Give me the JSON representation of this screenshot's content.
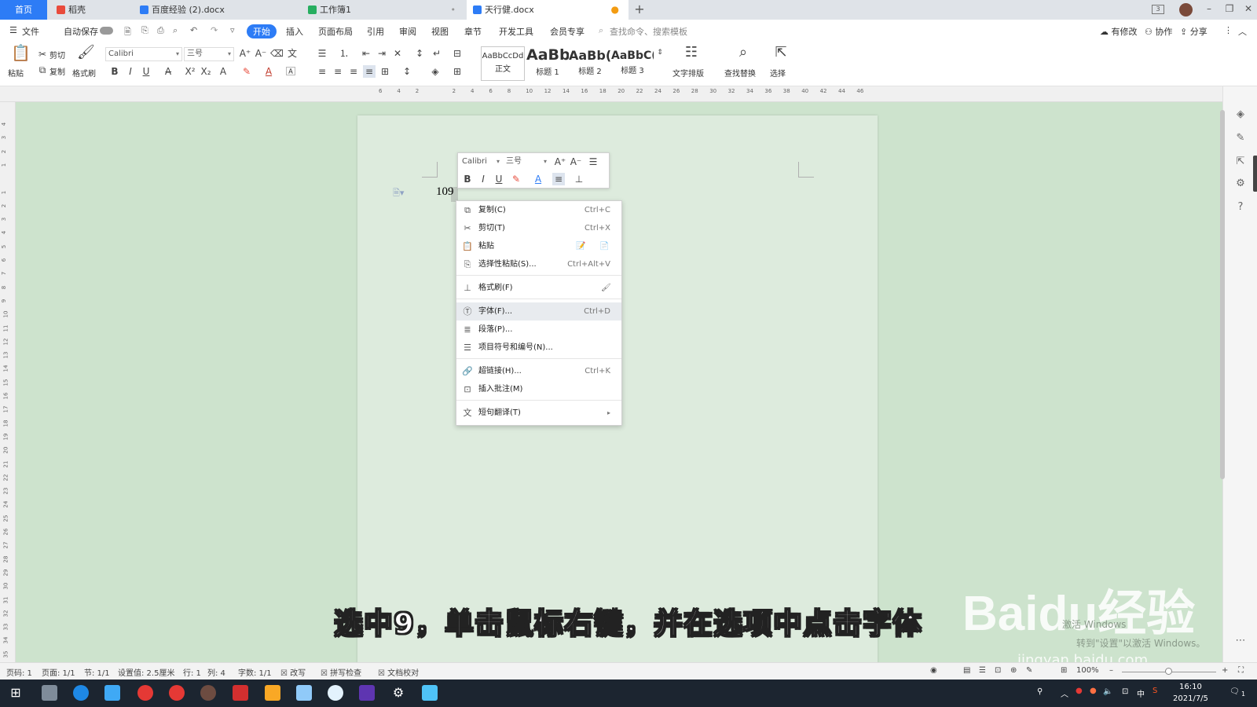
{
  "tabs": [
    {
      "label": "首页",
      "kind": "home"
    },
    {
      "label": "稻壳",
      "icon": "daoke-icon",
      "color": "#e94b3c"
    },
    {
      "label": "百度经验 (2).docx",
      "icon": "word-doc-icon",
      "color": "#2d7cf6"
    },
    {
      "label": "工作簿1",
      "icon": "sheet-icon",
      "color": "#27ae60"
    },
    {
      "label": "天行健.docx",
      "icon": "word-doc-icon",
      "color": "#2d7cf6",
      "active": true
    }
  ],
  "window": {
    "badge": "3",
    "add": "+",
    "min": "–",
    "max": "❐",
    "close": "✕"
  },
  "menu": {
    "file": "文件",
    "autosave": "自动保存",
    "items": [
      "开始",
      "插入",
      "页面布局",
      "引用",
      "审阅",
      "视图",
      "章节",
      "开发工具",
      "会员专享"
    ],
    "search_placeholder": "查找命令、搜索模板",
    "right": [
      "有修改",
      "协作",
      "分享"
    ]
  },
  "ribbon": {
    "paste": "粘贴",
    "cut": "剪切",
    "copy": "复制",
    "format_painter": "格式刷",
    "font_name": "Calibri",
    "font_size": "三号",
    "styles": [
      {
        "preview": "AaBbCcDd",
        "label": "正文"
      },
      {
        "preview": "AaBb",
        "label": "标题 1"
      },
      {
        "preview": "AaBb(",
        "label": "标题 2"
      },
      {
        "preview": "AaBbC(",
        "label": "标题 3"
      }
    ],
    "text_layout": "文字排版",
    "find_replace": "查找替换",
    "select": "选择"
  },
  "ruler": {
    "h_ticks": [
      "6",
      "4",
      "2",
      "",
      "2",
      "4",
      "6",
      "8",
      "10",
      "12",
      "14",
      "16",
      "18",
      "20",
      "22",
      "24",
      "26",
      "28",
      "30",
      "32",
      "34",
      "36",
      "38",
      "40",
      "42",
      "44",
      "46"
    ],
    "v_ticks": [
      "4",
      "3",
      "2",
      "1",
      "",
      "1",
      "2",
      "3",
      "4",
      "5",
      "6",
      "7",
      "8",
      "9",
      "10",
      "11",
      "12",
      "13",
      "14",
      "15",
      "16",
      "17",
      "18",
      "19",
      "20",
      "21",
      "22",
      "23",
      "24",
      "25",
      "26",
      "27",
      "28",
      "29",
      "30",
      "31",
      "32",
      "33",
      "34",
      "35"
    ]
  },
  "document": {
    "text": "109"
  },
  "mini_toolbar": {
    "font_name": "Calibri",
    "font_size": "三号"
  },
  "context_menu": [
    {
      "label": "复制(C)",
      "shortcut": "Ctrl+C",
      "icon": "copy-icon"
    },
    {
      "label": "剪切(T)",
      "shortcut": "Ctrl+X",
      "icon": "scissors-icon"
    },
    {
      "label": "粘贴",
      "shortcut": "",
      "icon": "paste-icon"
    },
    {
      "label": "选择性粘贴(S)...",
      "shortcut": "Ctrl+Alt+V",
      "icon": "paste-special-icon"
    },
    {
      "label": "格式刷(F)",
      "shortcut": "",
      "icon": "format-painter-icon"
    },
    {
      "label": "字体(F)...",
      "shortcut": "Ctrl+D",
      "icon": "font-icon",
      "highlighted": true
    },
    {
      "label": "段落(P)...",
      "shortcut": "",
      "icon": "paragraph-icon"
    },
    {
      "label": "项目符号和编号(N)...",
      "shortcut": "",
      "icon": "bullets-icon"
    },
    {
      "label": "超链接(H)...",
      "shortcut": "Ctrl+K",
      "icon": "link-icon"
    },
    {
      "label": "插入批注(M)",
      "shortcut": "",
      "icon": "comment-icon"
    },
    {
      "label": "短句翻译(T)",
      "shortcut": "",
      "icon": "translate-icon",
      "submenu": true
    }
  ],
  "status": {
    "page_num": "页码: 1",
    "pages": "页面: 1/1",
    "section": "节: 1/1",
    "setting": "设置值: 2.5厘米",
    "row": "行: 1",
    "col": "列: 4",
    "words": "字数: 1/1",
    "revise": "改写",
    "spell": "拼写检查",
    "proof": "文档校对",
    "zoom": "100%"
  },
  "subtitle": "选中9，单击鼠标右键，并在选项中点击字体",
  "watermark": {
    "brand": "Baidu经验",
    "url": "jingyan.baidu.com",
    "activate": "激活 Windows",
    "activate2": "转到\"设置\"以激活 Windows。"
  },
  "taskbar": {
    "time": "16:10",
    "date": "2021/7/5",
    "ime": "中",
    "notif": "1"
  }
}
